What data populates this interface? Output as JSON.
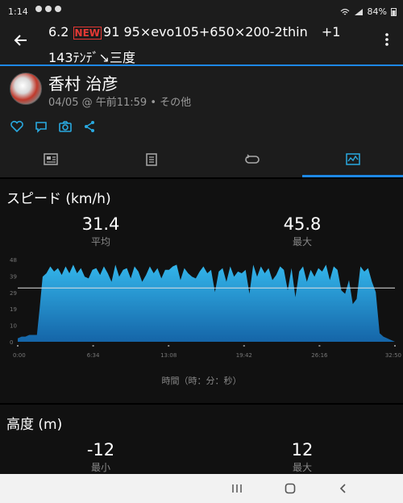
{
  "status_bar": {
    "time": "1:14",
    "battery": "84%"
  },
  "header": {
    "title_line1_pre": "6.2",
    "new_badge": "NEW",
    "title_line1_post": "91 95×evo105+650×200-2thin",
    "plus_count": "+1",
    "title_line2": "143ﾃﾝﾃﾞ↘三度"
  },
  "profile": {
    "name": "香村 治彦",
    "meta": "04/05 @ 午前11:59 • その他"
  },
  "tabs": [
    {
      "icon": "overview-icon"
    },
    {
      "icon": "details-icon"
    },
    {
      "icon": "laps-icon"
    },
    {
      "icon": "chart-icon",
      "active": true
    }
  ],
  "speed": {
    "title": "スピード (km/h)",
    "avg_value": "31.4",
    "avg_label": "平均",
    "max_value": "45.8",
    "max_label": "最大",
    "x_axis_title": "時間（時：分：秒）"
  },
  "altitude": {
    "title": "高度 (m)",
    "min_value": "-12",
    "min_label": "最小",
    "max_value": "12",
    "max_label": "最大"
  },
  "chart_data": {
    "type": "area",
    "title": "スピード (km/h)",
    "xlabel": "時間（時：分：秒）",
    "ylabel": "",
    "x_ticks": [
      "0:00",
      "6:34",
      "13:08",
      "19:42",
      "26:16",
      "32:50"
    ],
    "y_ticks": [
      "0",
      "10",
      "19",
      "29",
      "39",
      "48"
    ],
    "ylim": [
      0,
      48
    ],
    "xlim_seconds": [
      0,
      1970
    ],
    "avg_line": 31.4,
    "fill_color": "#29a9e0",
    "x_seconds": [
      0,
      20,
      40,
      60,
      80,
      100,
      115,
      130,
      150,
      170,
      190,
      210,
      230,
      250,
      270,
      290,
      310,
      330,
      350,
      370,
      390,
      410,
      430,
      450,
      470,
      490,
      510,
      530,
      550,
      570,
      590,
      610,
      630,
      650,
      670,
      690,
      710,
      730,
      750,
      770,
      790,
      810,
      830,
      850,
      870,
      890,
      910,
      930,
      950,
      970,
      990,
      1010,
      1030,
      1050,
      1070,
      1090,
      1110,
      1130,
      1150,
      1170,
      1190,
      1210,
      1230,
      1250,
      1270,
      1290,
      1310,
      1330,
      1350,
      1370,
      1390,
      1410,
      1430,
      1450,
      1470,
      1490,
      1510,
      1530,
      1550,
      1570,
      1590,
      1610,
      1630,
      1650,
      1670,
      1690,
      1710,
      1730,
      1750,
      1770,
      1790,
      1810,
      1830,
      1850,
      1870,
      1890,
      1910,
      1930,
      1950,
      1970
    ],
    "speed_kmh": [
      2,
      3,
      3,
      4,
      4,
      4,
      20,
      38,
      40,
      44,
      41,
      43,
      39,
      44,
      40,
      45,
      40,
      43,
      38,
      37,
      42,
      43,
      39,
      44,
      40,
      35,
      45,
      38,
      42,
      43,
      37,
      44,
      41,
      35,
      39,
      44,
      40,
      43,
      37,
      42,
      42,
      44,
      45,
      36,
      43,
      40,
      38,
      37,
      41,
      44,
      40,
      42,
      29,
      41,
      43,
      35,
      44,
      38,
      41,
      40,
      42,
      28,
      45,
      38,
      44,
      40,
      43,
      36,
      39,
      44,
      42,
      30,
      43,
      26,
      41,
      44,
      35,
      42,
      38,
      43,
      41,
      45,
      36,
      44,
      42,
      30,
      28,
      36,
      22,
      25,
      44,
      41,
      43,
      35,
      29,
      5,
      3,
      2,
      1,
      0
    ]
  }
}
